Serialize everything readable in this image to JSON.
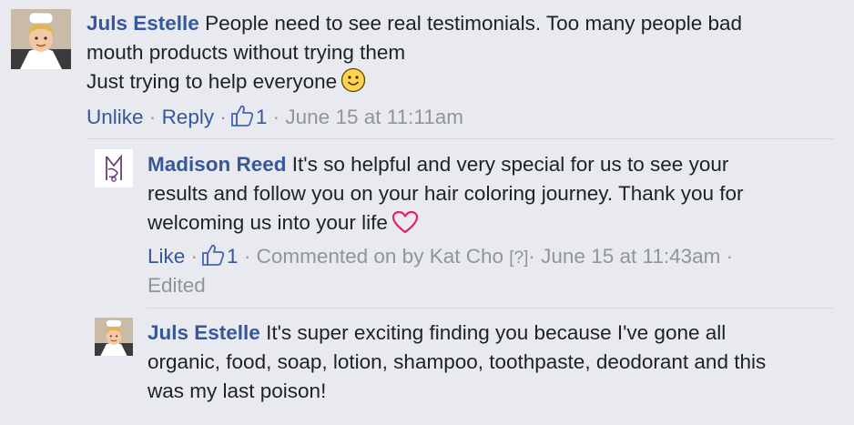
{
  "comments": [
    {
      "author": "Juls Estelle",
      "lines": [
        "People need to see real testimonials. Too many people bad",
        "mouth products without trying them",
        "Just trying to help everyone"
      ],
      "actions": {
        "unlike": "Unlike",
        "sep1": "·",
        "reply": "Reply",
        "sep2": "·",
        "like_count": "1",
        "sep3": "·",
        "timestamp": "June 15 at 11:11am"
      }
    },
    {
      "author": "Madison Reed",
      "lines": [
        "It's so helpful and very special for us to see your",
        "results and follow you on your hair coloring journey. Thank you for",
        "welcoming us into your life"
      ],
      "actions": {
        "like": "Like",
        "sep1": "·",
        "like_count": "1",
        "sep2": "·",
        "commented_by": "Commented on by Kat Cho",
        "help": "[?]",
        "sep3": "·",
        "timestamp": "June 15 at 11:43am",
        "sep4": "·",
        "edited": "Edited"
      }
    },
    {
      "author": "Juls Estelle",
      "lines": [
        "It's super exciting finding you because I've gone all",
        "organic, food, soap, lotion, shampoo, toothpaste, deodorant and this",
        "was my last poison!"
      ]
    }
  ],
  "colors": {
    "background": "#e9eaef",
    "link": "#365899",
    "meta": "#90949c",
    "text": "#1d2129",
    "heart": "#e0245e"
  },
  "icons": {
    "smile": "smiley-emoji-icon",
    "heart": "heart-emoji-icon",
    "like": "thumbs-up-icon"
  }
}
